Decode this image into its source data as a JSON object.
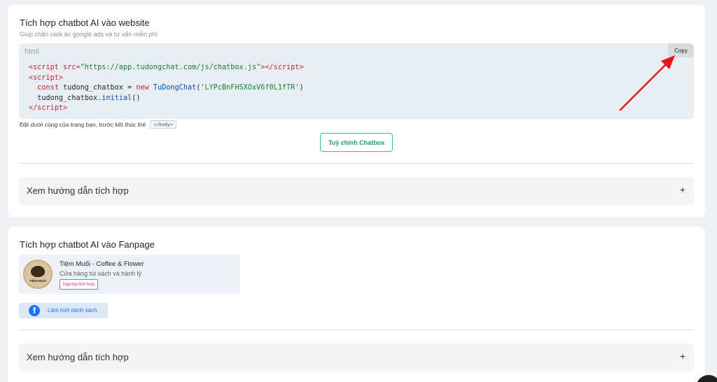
{
  "website_section": {
    "title": "Tích hợp chatbot AI vào website",
    "subtitle": "Giúp chặn click ảo google ads và tư vấn miễn phí",
    "code_lang": "html",
    "copy_label": "Copy",
    "code": {
      "l1_open": "<script",
      "l1_attr": " src=",
      "l1_str": "\"https://app.tudongchat.com/js/chatbox.js\"",
      "l1_close": "></",
      "l1_tag": "script",
      "l1_end": ">",
      "l2_open": "<",
      "l2_tag": "script",
      "l2_end": ">",
      "l3_kw": "const",
      "l3_var": " tudong_chatbox = ",
      "l3_new": "new",
      "l3_fn": " TuDongChat",
      "l3_paren": "(",
      "l3_str": "'LYPcBnFHSXOxV6f0L1fTR'",
      "l3_close": ")",
      "l4_obj": "tudong_chatbox.",
      "l4_fn": "initial",
      "l4_end": "()",
      "l5_open": "</",
      "l5_tag": "script",
      "l5_end": ">"
    },
    "note": "Đặt dưới cùng của trang bạn, trước kết thúc thẻ",
    "note_tag": "</body>",
    "customize_label": "Tuỳ chỉnh Chatbox",
    "guide_label": "Xem hướng dẫn tích hợp",
    "guide_toggle": "+"
  },
  "fanpage_section": {
    "title": "Tích hợp chatbot AI vào Fanpage",
    "page": {
      "name": "Tiệm Muối - Coffee & Flower",
      "description": "Cửa hàng túi xách và hành lý",
      "logo_text": "TIỆM MUỐI",
      "stop_label": "Ngưng tích hợp"
    },
    "refresh_label": "Làm mới danh sách",
    "fb_icon": "f",
    "guide_label": "Xem hướng dẫn tích hợp",
    "guide_toggle": "+"
  },
  "colors": {
    "accent_green": "#22a06b",
    "facebook_blue": "#1877f2",
    "danger_pink": "#d6336c",
    "arrow_red": "#e8141b"
  }
}
